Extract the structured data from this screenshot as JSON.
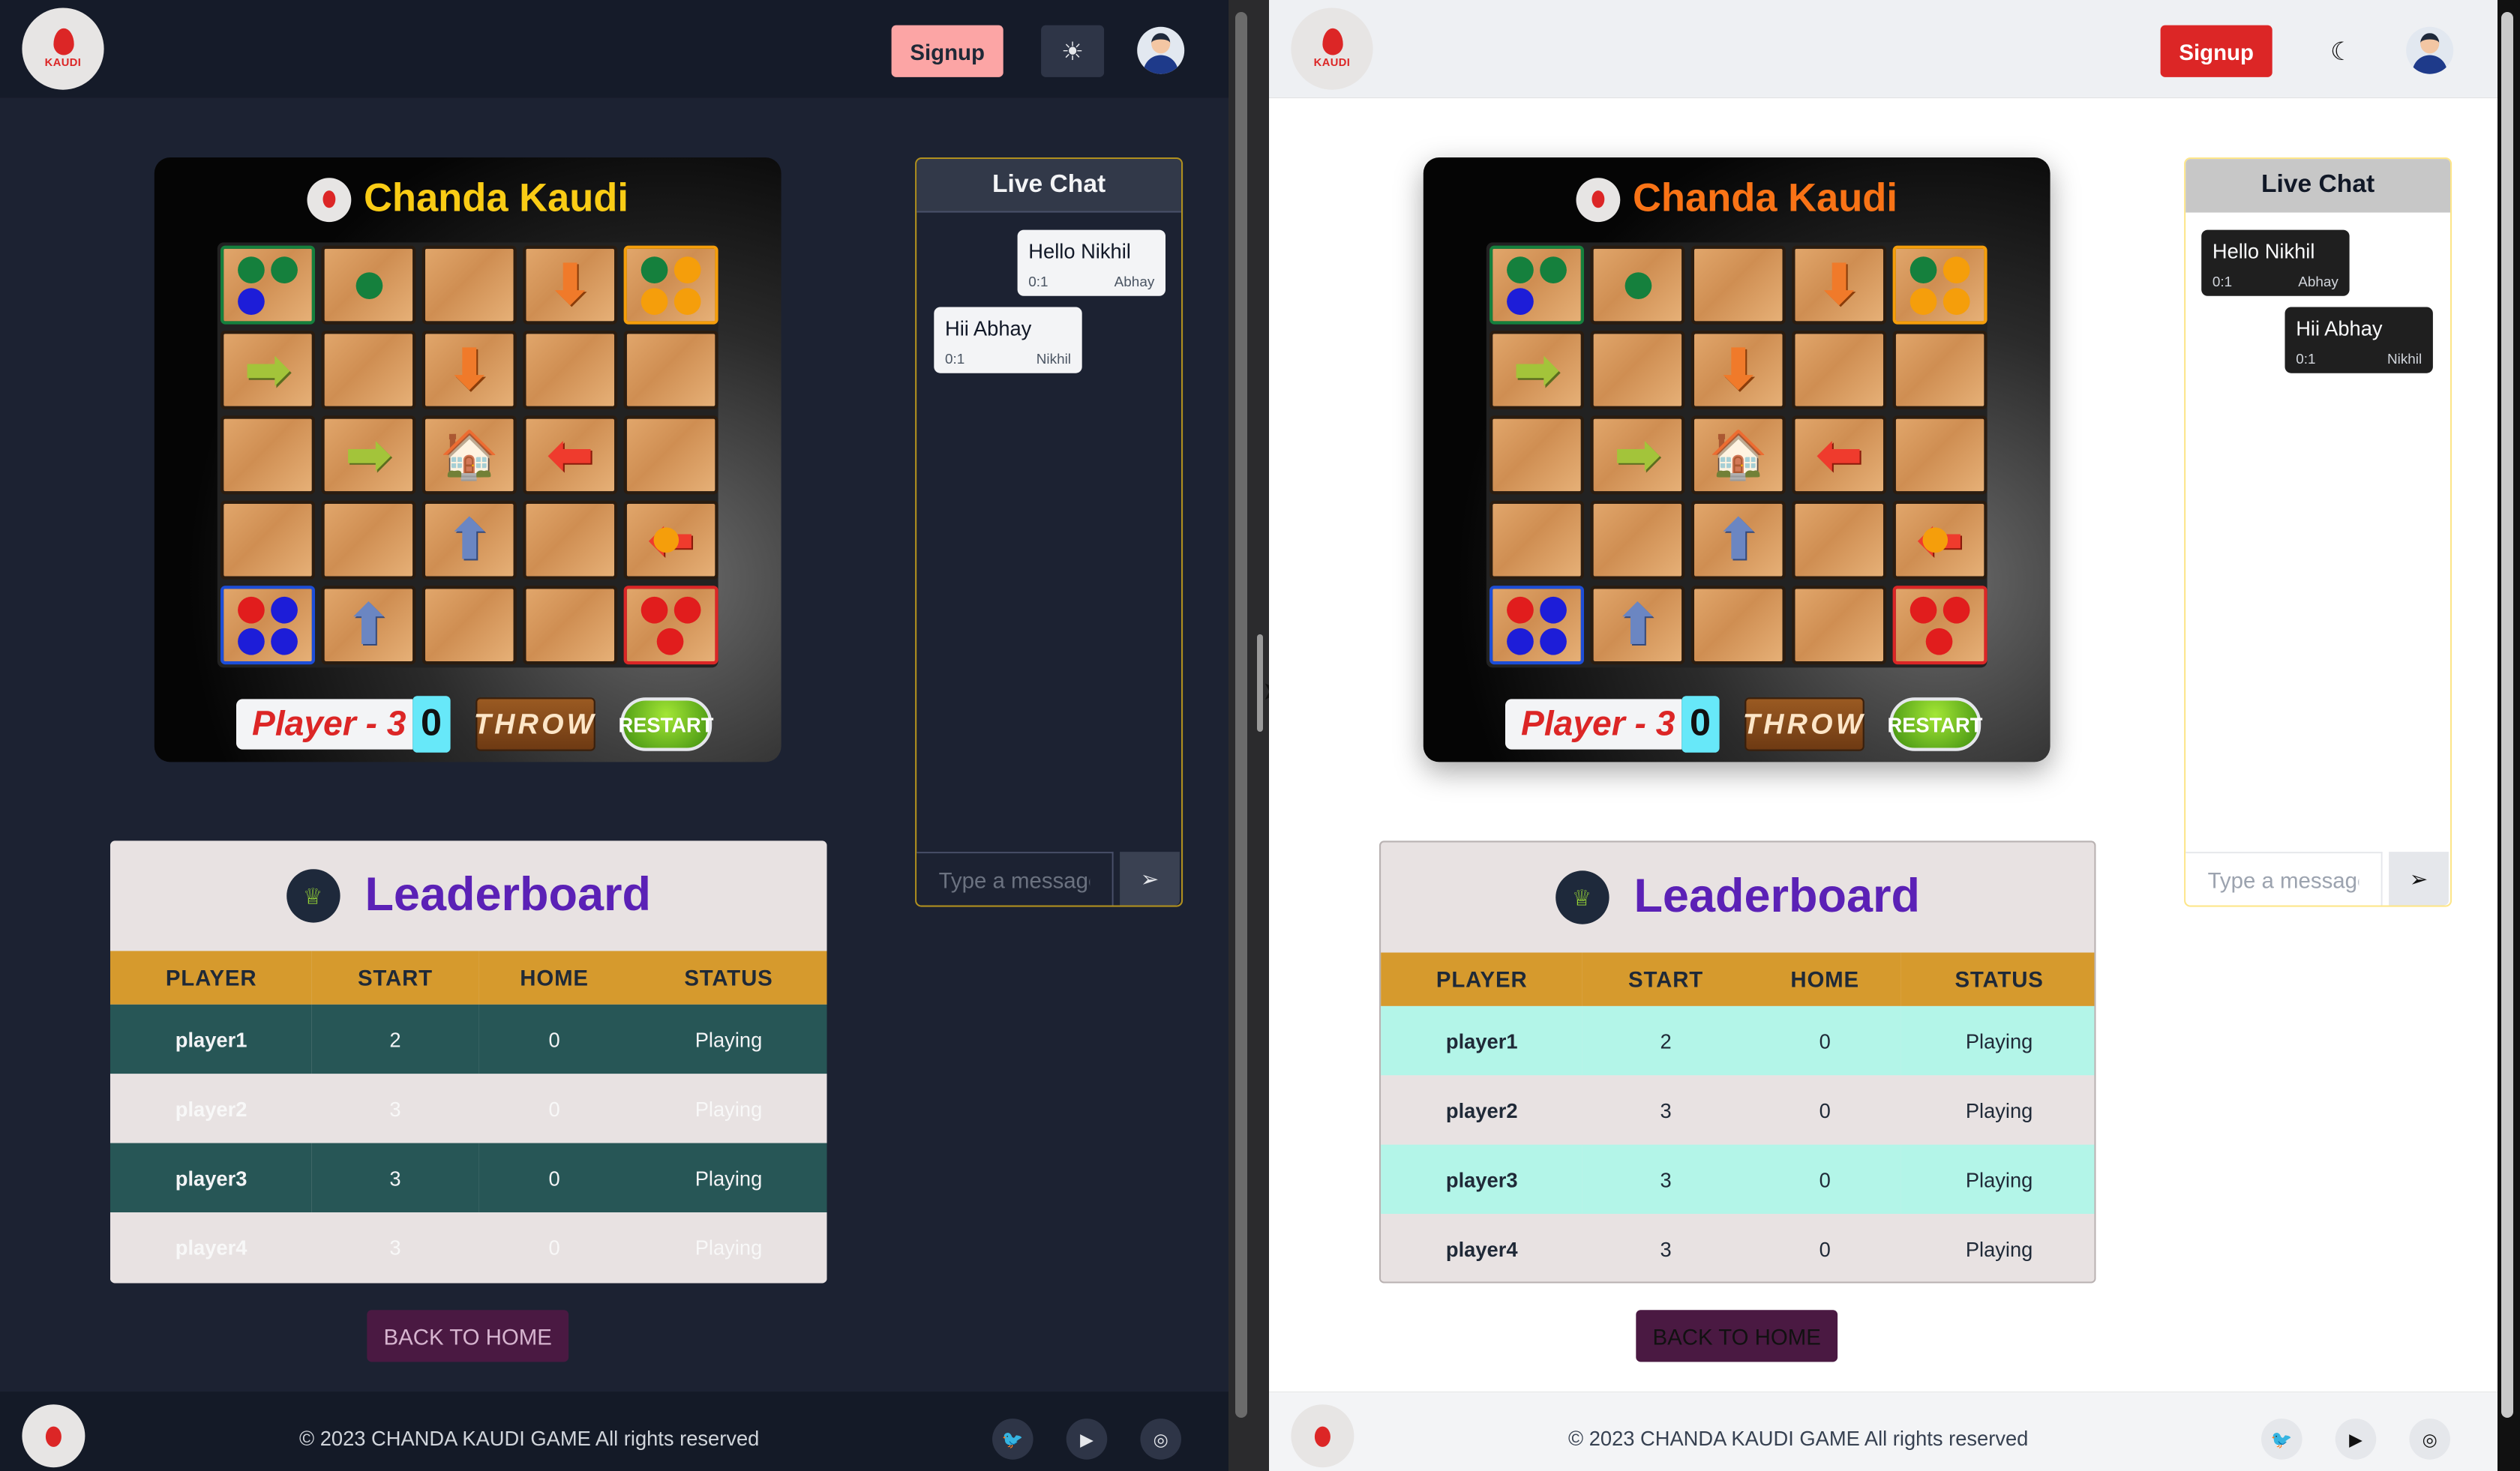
{
  "nav": {
    "logo_text": "KAUDI",
    "signup_label": "Signup",
    "dark_theme_icon": "sun-icon",
    "light_theme_icon": "moon-icon"
  },
  "game": {
    "title": "Chanda Kaudi",
    "player_label": "Player - 3",
    "dice_value": "0",
    "throw_label": "THROW",
    "restart_label": "RESTART",
    "board": [
      [
        "green-piece x3",
        "green-piece x1",
        "empty",
        "arrow-down orange",
        "orange-piece x4"
      ],
      [
        "arrow-right green",
        "empty",
        "arrow-down orange",
        "empty",
        "empty"
      ],
      [
        "empty",
        "arrow-right green",
        "home",
        "arrow-left red",
        "empty"
      ],
      [
        "empty",
        "empty",
        "arrow-up blue",
        "empty",
        "arrow-left red + orange-piece"
      ],
      [
        "blue-piece x4",
        "arrow-up blue",
        "empty",
        "empty",
        "red-piece x3"
      ]
    ],
    "colors": {
      "green": "#15803d",
      "orange": "#f59e0b",
      "blue": "#1d1dd8",
      "red": "#e11d1d"
    }
  },
  "chat": {
    "title": "Live Chat",
    "input_placeholder": "Type a message",
    "send_icon": "send-icon",
    "messages": [
      {
        "text": "Hello Nikhil",
        "time": "0:1",
        "sender": "Abhay"
      },
      {
        "text": "Hii Abhay",
        "time": "0:1",
        "sender": "Nikhil"
      }
    ]
  },
  "leaderboard": {
    "title": "Leaderboard",
    "columns": [
      "PLAYER",
      "START",
      "HOME",
      "STATUS"
    ],
    "rows": [
      {
        "player": "player1",
        "start": "2",
        "home": "0",
        "status": "Playing"
      },
      {
        "player": "player2",
        "start": "3",
        "home": "0",
        "status": "Playing"
      },
      {
        "player": "player3",
        "start": "3",
        "home": "0",
        "status": "Playing"
      },
      {
        "player": "player4",
        "start": "3",
        "home": "0",
        "status": "Playing"
      }
    ]
  },
  "back_label": "BACK TO HOME",
  "footer": {
    "copyright": "© 2023 CHANDA KAUDI GAME All rights reserved",
    "social_icons": [
      "twitter-icon",
      "youtube-icon",
      "instagram-icon"
    ]
  }
}
